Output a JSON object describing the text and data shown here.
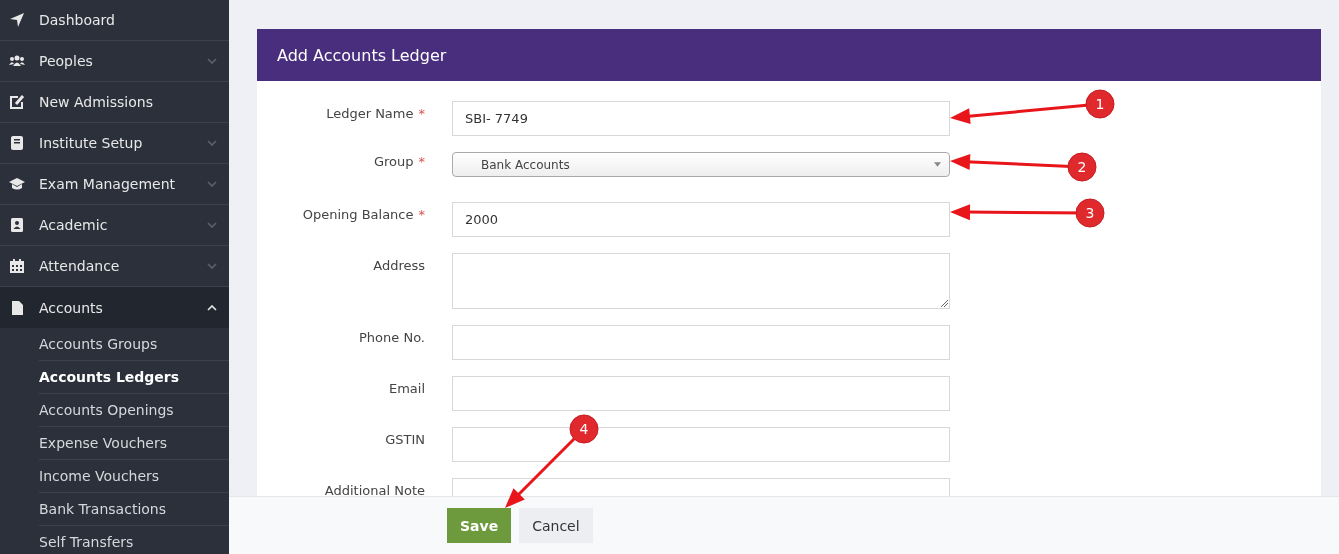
{
  "sidebar": {
    "items": [
      {
        "label": "Dashboard",
        "expandable": false,
        "expanded": false
      },
      {
        "label": "Peoples",
        "expandable": true,
        "expanded": false
      },
      {
        "label": "New Admissions",
        "expandable": false,
        "expanded": false
      },
      {
        "label": "Institute Setup",
        "expandable": true,
        "expanded": false
      },
      {
        "label": "Exam Management",
        "expandable": true,
        "expanded": false
      },
      {
        "label": "Academic",
        "expandable": true,
        "expanded": false
      },
      {
        "label": "Attendance",
        "expandable": true,
        "expanded": false
      },
      {
        "label": "Accounts",
        "expandable": true,
        "expanded": true,
        "children": [
          {
            "label": "Accounts Groups",
            "selected": false
          },
          {
            "label": "Accounts Ledgers",
            "selected": true
          },
          {
            "label": "Accounts Openings",
            "selected": false
          },
          {
            "label": "Expense Vouchers",
            "selected": false
          },
          {
            "label": "Income Vouchers",
            "selected": false
          },
          {
            "label": "Bank Transactions",
            "selected": false
          },
          {
            "label": "Self Transfers",
            "selected": false
          }
        ]
      }
    ]
  },
  "form": {
    "title": "Add Accounts Ledger",
    "fields": [
      {
        "kind": "text",
        "label": "Ledger Name",
        "required_mark": "*",
        "value": "SBI- 7749"
      },
      {
        "kind": "select",
        "label": "Group",
        "required_mark": "*",
        "value": "Bank Accounts"
      },
      {
        "kind": "text",
        "label": "Opening Balance",
        "required_mark": "*",
        "value": "2000"
      },
      {
        "kind": "textarea",
        "label": "Address"
      },
      {
        "kind": "text",
        "label": "Phone No."
      },
      {
        "kind": "text",
        "label": "Email"
      },
      {
        "kind": "text",
        "label": "GSTIN"
      },
      {
        "kind": "text",
        "label": "Additional Note"
      }
    ]
  },
  "buttons": [
    {
      "label": "Save",
      "kind": "primary"
    },
    {
      "label": "Cancel",
      "kind": "secondary"
    }
  ],
  "annotations": [
    {
      "label": "1"
    },
    {
      "label": "2"
    },
    {
      "label": "3"
    },
    {
      "label": "4"
    }
  ]
}
